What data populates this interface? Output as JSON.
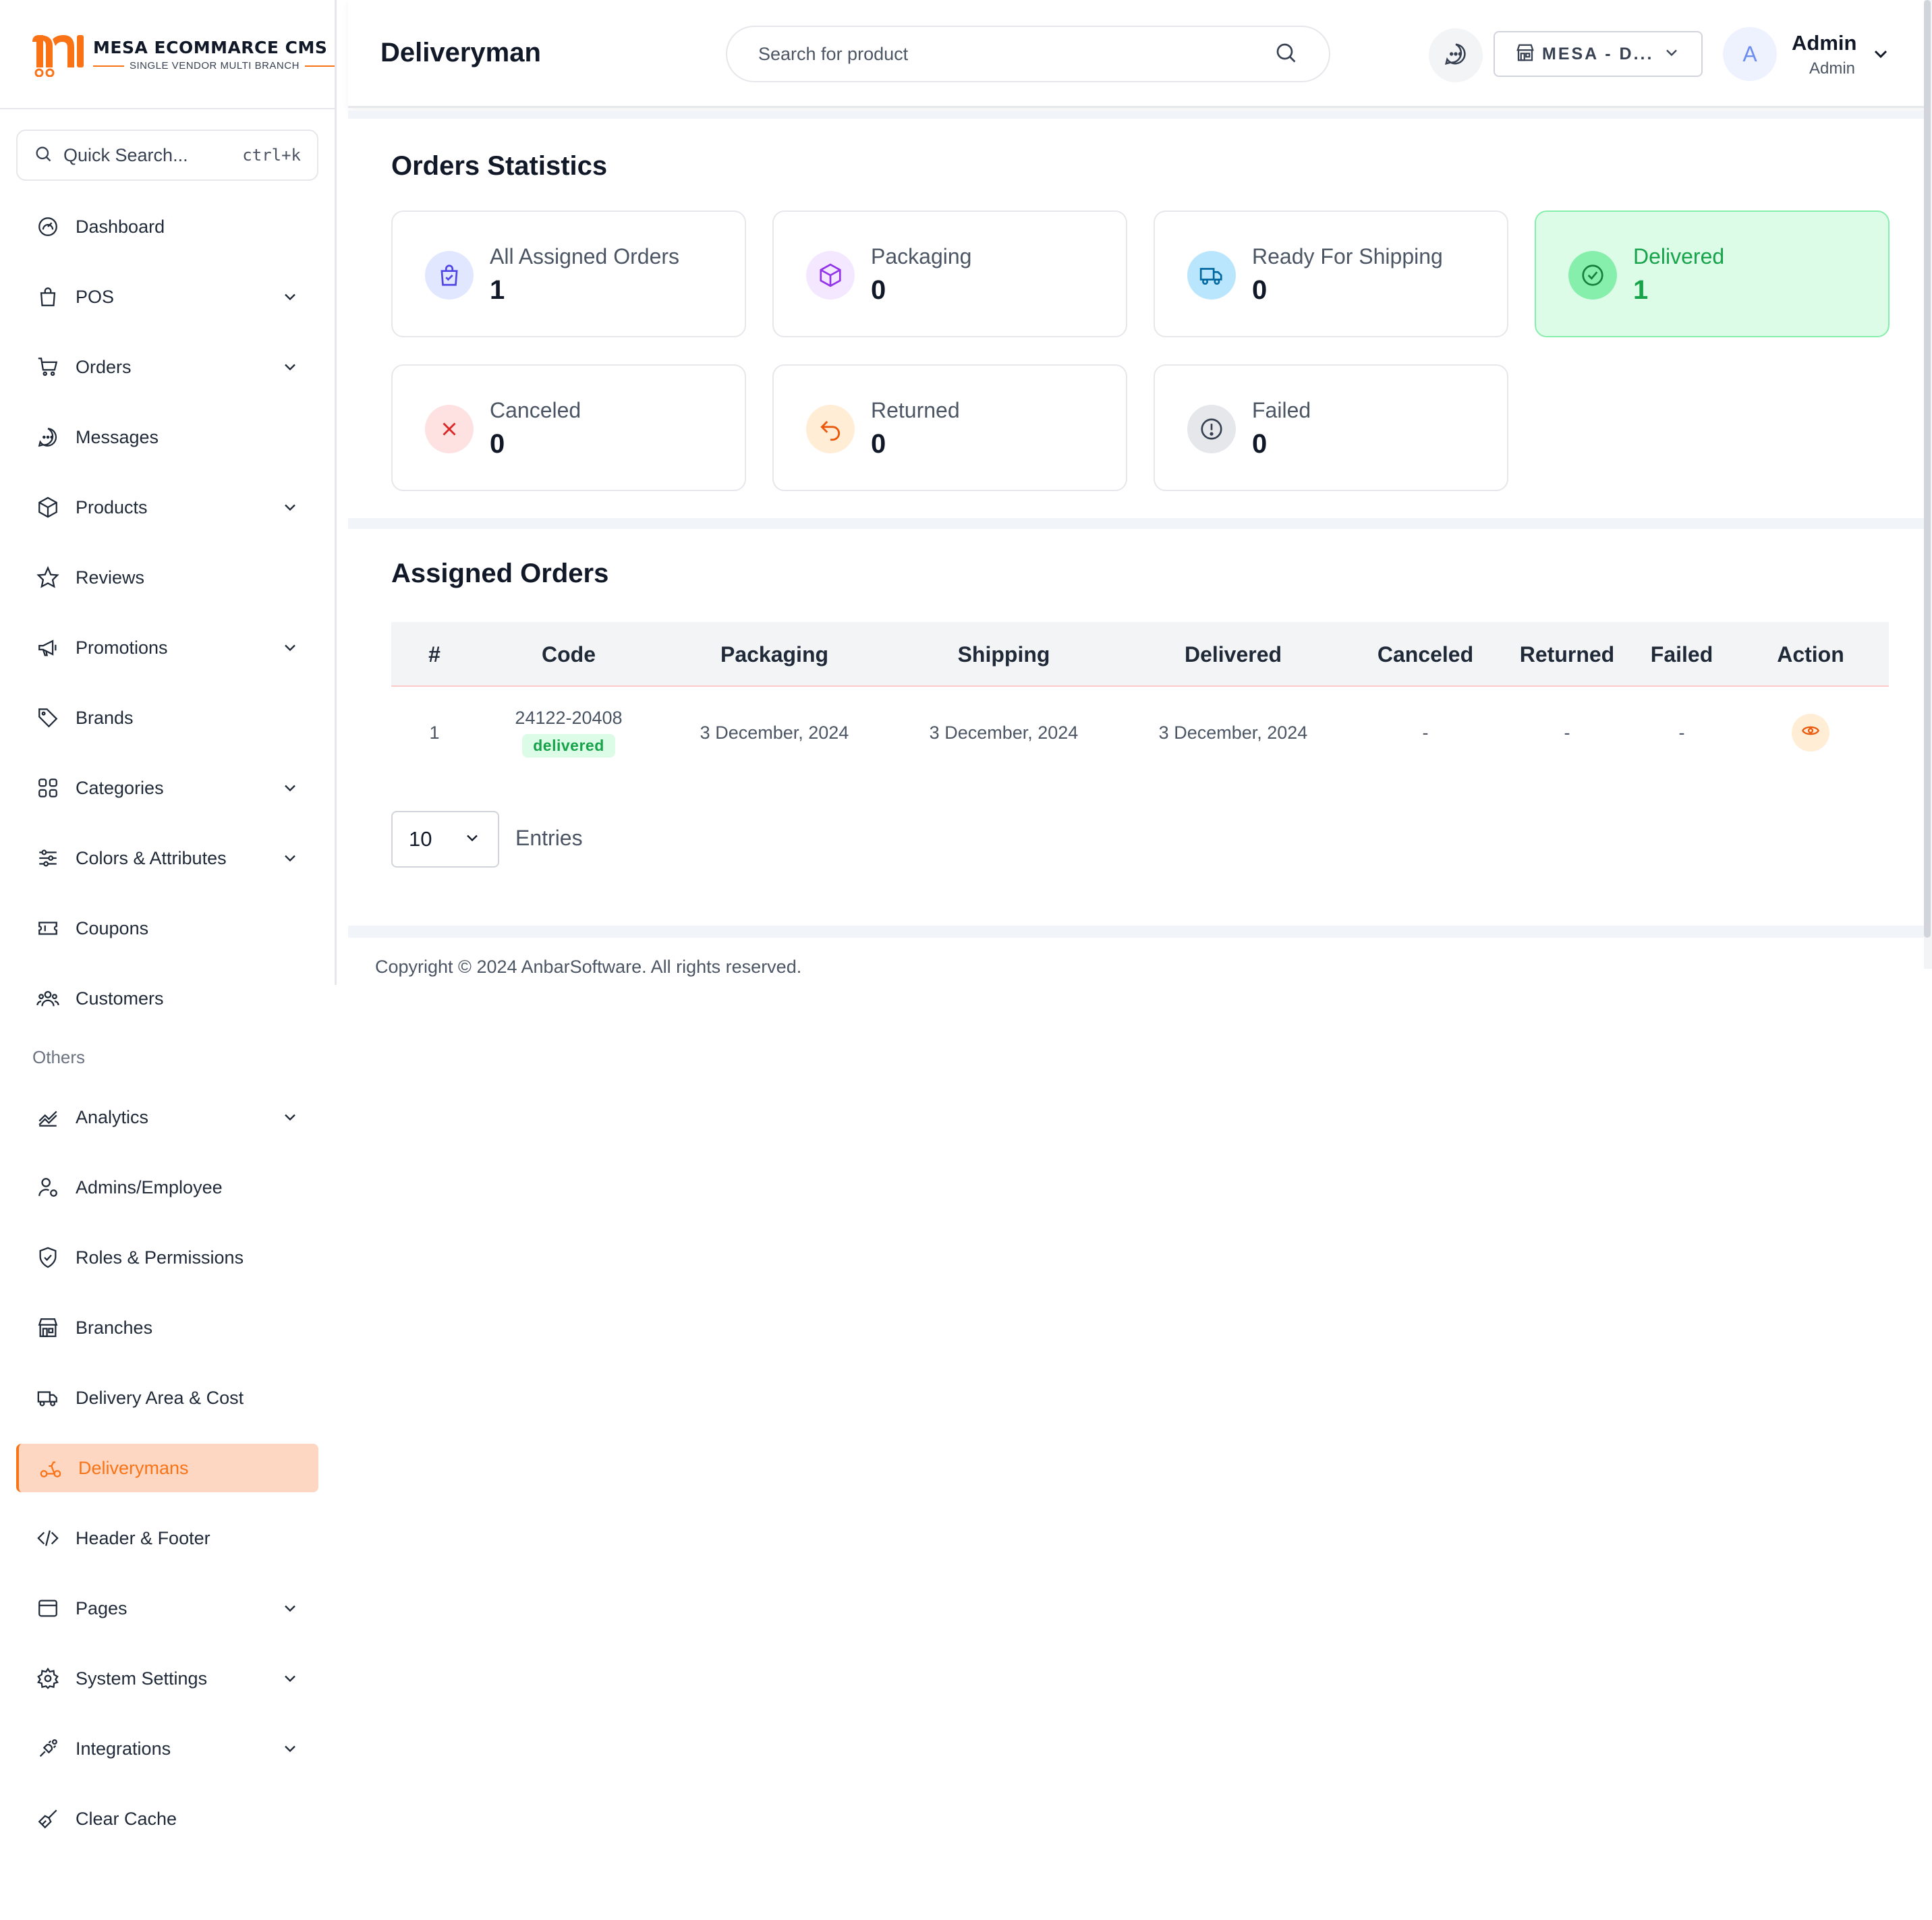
{
  "brand": {
    "title": "MESA ECOMMARCE CMS",
    "subtitle": "SINGLE VENDOR MULTI BRANCH",
    "accent": "#f97316"
  },
  "sidebar": {
    "quick_search": {
      "label": "Quick Search...",
      "shortcut": "ctrl+k"
    },
    "items": [
      {
        "label": "Dashboard",
        "icon": "gauge-icon",
        "has_children": false
      },
      {
        "label": "POS",
        "icon": "shopping-bag-icon",
        "has_children": true
      },
      {
        "label": "Orders",
        "icon": "cart-icon",
        "has_children": true
      },
      {
        "label": "Messages",
        "icon": "chat-icon",
        "has_children": false
      },
      {
        "label": "Products",
        "icon": "box-icon",
        "has_children": true
      },
      {
        "label": "Reviews",
        "icon": "star-icon",
        "has_children": false
      },
      {
        "label": "Promotions",
        "icon": "megaphone-icon",
        "has_children": true
      },
      {
        "label": "Brands",
        "icon": "tag-icon",
        "has_children": false
      },
      {
        "label": "Categories",
        "icon": "grid-icon",
        "has_children": true
      },
      {
        "label": "Colors & Attributes",
        "icon": "sliders-icon",
        "has_children": true
      },
      {
        "label": "Coupons",
        "icon": "ticket-icon",
        "has_children": false
      },
      {
        "label": "Customers",
        "icon": "users-icon",
        "has_children": false
      }
    ],
    "section_label": "Others",
    "others": [
      {
        "label": "Analytics",
        "icon": "chart-icon",
        "has_children": true
      },
      {
        "label": "Admins/Employee",
        "icon": "user-gear-icon",
        "has_children": false
      },
      {
        "label": "Roles & Permissions",
        "icon": "shield-check-icon",
        "has_children": false
      },
      {
        "label": "Branches",
        "icon": "store-icon",
        "has_children": false
      },
      {
        "label": "Delivery Area & Cost",
        "icon": "truck-icon",
        "has_children": false
      },
      {
        "label": "Deliverymans",
        "icon": "scooter-icon",
        "has_children": false,
        "active": true
      },
      {
        "label": "Header & Footer",
        "icon": "code-icon",
        "has_children": false
      },
      {
        "label": "Pages",
        "icon": "browser-icon",
        "has_children": true
      },
      {
        "label": "System Settings",
        "icon": "gear-icon",
        "has_children": true
      },
      {
        "label": "Integrations",
        "icon": "plug-icon",
        "has_children": true
      },
      {
        "label": "Clear Cache",
        "icon": "broom-icon",
        "has_children": false
      }
    ]
  },
  "header": {
    "page_title": "Deliveryman",
    "search_placeholder": "Search for product",
    "branch_label": "MESA - D...",
    "avatar_initial": "A",
    "user_name": "Admin",
    "user_role": "Admin"
  },
  "stats": {
    "title": "Orders Statistics",
    "cards": [
      {
        "label": "All Assigned Orders",
        "value": "1",
        "icon": "bag-check-icon",
        "color": "#4f46e5",
        "bg": "#e0e7ff"
      },
      {
        "label": "Packaging",
        "value": "0",
        "icon": "package-icon",
        "color": "#9333ea",
        "bg": "#f3e8ff"
      },
      {
        "label": "Ready For Shipping",
        "value": "0",
        "icon": "truck-icon",
        "color": "#0284c7",
        "bg": "#bae6fd"
      },
      {
        "label": "Delivered",
        "value": "1",
        "icon": "check-circle-icon",
        "color": "#16a34a",
        "bg": "#86efac"
      },
      {
        "label": "Canceled",
        "value": "0",
        "icon": "x-icon",
        "color": "#dc2626",
        "bg": "#fee2e2"
      },
      {
        "label": "Returned",
        "value": "0",
        "icon": "return-arrow-icon",
        "color": "#ea580c",
        "bg": "#ffedd5"
      },
      {
        "label": "Failed",
        "value": "0",
        "icon": "alert-circle-icon",
        "color": "#374151",
        "bg": "#e5e7eb"
      }
    ]
  },
  "orders": {
    "title": "Assigned Orders",
    "columns": [
      "#",
      "Code",
      "Packaging",
      "Shipping",
      "Delivered",
      "Canceled",
      "Returned",
      "Failed",
      "Action"
    ],
    "rows": [
      {
        "index": "1",
        "code": "24122-20408",
        "status": "delivered",
        "packaging": "3 December, 2024",
        "shipping": "3 December, 2024",
        "delivered": "3 December, 2024",
        "canceled": "-",
        "returned": "-",
        "failed": "-"
      }
    ],
    "entries_value": "10",
    "entries_label": "Entries"
  },
  "footer": {
    "copyright": "Copyright © 2024 AnbarSoftware. All rights reserved."
  }
}
